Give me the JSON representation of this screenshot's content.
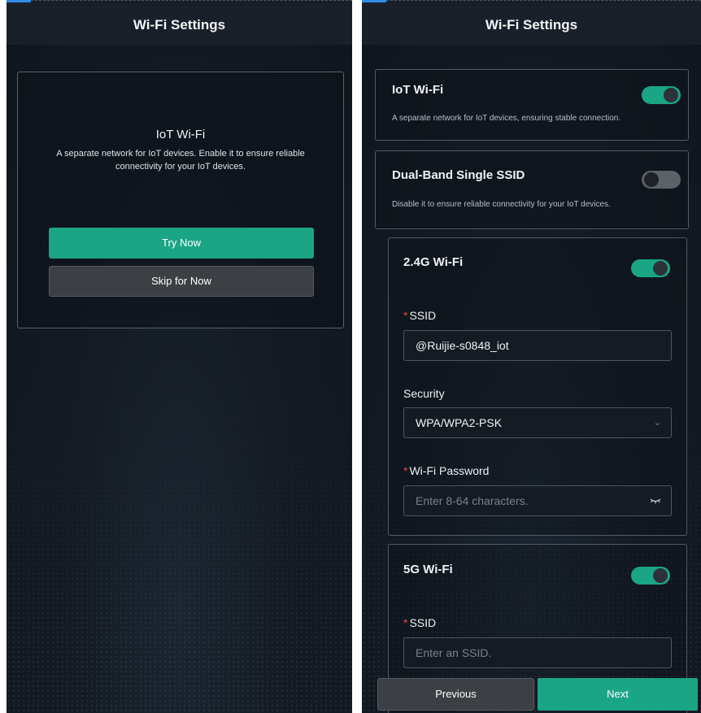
{
  "left": {
    "header": {
      "title": "Wi-Fi Settings"
    },
    "intro": {
      "title": "IoT Wi-Fi",
      "description": "A separate network for IoT devices. Enable it to ensure reliable connectivity for your IoT devices.",
      "try_label": "Try Now",
      "skip_label": "Skip for Now"
    }
  },
  "right": {
    "header": {
      "title": "Wi-Fi Settings"
    },
    "iot": {
      "title": "IoT Wi-Fi",
      "description": "A separate network for IoT devices, ensuring stable connection.",
      "enabled": true
    },
    "dual_band": {
      "title": "Dual-Band Single SSID",
      "description": "Disable it to ensure reliable connectivity for your IoT devices.",
      "enabled": false
    },
    "wifi_24g": {
      "title": "2.4G Wi-Fi",
      "enabled": true,
      "ssid_label": "SSID",
      "ssid_value": "@Ruijie-s0848_iot",
      "security_label": "Security",
      "security_value": "WPA/WPA2-PSK",
      "password_label": "Wi-Fi Password",
      "password_placeholder": "Enter 8-64 characters."
    },
    "wifi_5g": {
      "title": "5G Wi-Fi",
      "enabled": true,
      "ssid_label": "SSID",
      "ssid_placeholder": "Enter an SSID."
    },
    "footer": {
      "previous_label": "Previous",
      "next_label": "Next"
    }
  },
  "colors": {
    "accent": "#1aa585",
    "required": "#e2483d",
    "header_accent": "#2f8fe8"
  }
}
